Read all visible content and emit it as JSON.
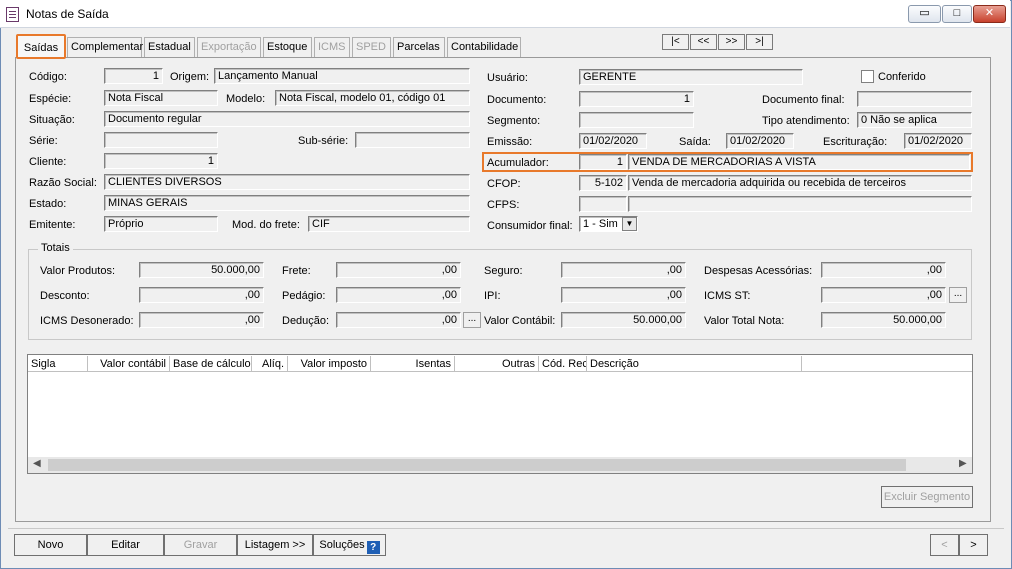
{
  "window": {
    "title": "Notas de Saída",
    "minimize": "▭",
    "maximize": "□",
    "close": "✕"
  },
  "tabs": [
    {
      "label": "Saídas",
      "active": true
    },
    {
      "label": "Complementar"
    },
    {
      "label": "Estadual"
    },
    {
      "label": "Exportação",
      "disabled": true
    },
    {
      "label": "Estoque"
    },
    {
      "label": "ICMS",
      "disabled": true
    },
    {
      "label": "SPED",
      "disabled": true
    },
    {
      "label": "Parcelas"
    },
    {
      "label": "Contabilidade"
    }
  ],
  "nav": {
    "first": "|<",
    "prev": "<<",
    "next": ">>",
    "last": ">|"
  },
  "form": {
    "codigo": {
      "label": "Código:",
      "value": "1"
    },
    "origem": {
      "label": "Origem:",
      "value": "Lançamento Manual"
    },
    "especie": {
      "label": "Espécie:",
      "value": "Nota Fiscal"
    },
    "modelo": {
      "label": "Modelo:",
      "value": "Nota Fiscal, modelo 01, código 01"
    },
    "situacao": {
      "label": "Situação:",
      "value": "Documento regular"
    },
    "serie": {
      "label": "Série:",
      "value": ""
    },
    "subserie": {
      "label": "Sub-série:",
      "value": ""
    },
    "cliente": {
      "label": "Cliente:",
      "value": "1"
    },
    "razao_social": {
      "label": "Razão Social:",
      "value": "CLIENTES DIVERSOS"
    },
    "estado": {
      "label": "Estado:",
      "value": "MINAS GERAIS"
    },
    "emitente": {
      "label": "Emitente:",
      "value": "Próprio"
    },
    "mod_frete": {
      "label": "Mod. do frete:",
      "value": "CIF"
    },
    "usuario": {
      "label": "Usuário:",
      "value": "GERENTE"
    },
    "conferido": {
      "label": "Conferido"
    },
    "documento": {
      "label": "Documento:",
      "value": "1"
    },
    "documento_final": {
      "label": "Documento final:",
      "value": ""
    },
    "segmento": {
      "label": "Segmento:",
      "value": ""
    },
    "tipo_atendimento": {
      "label": "Tipo atendimento:",
      "value": "0 Não se aplica"
    },
    "emissao": {
      "label": "Emissão:",
      "value": "01/02/2020"
    },
    "saida": {
      "label": "Saída:",
      "value": "01/02/2020"
    },
    "escrituracao": {
      "label": "Escrituração:",
      "value": "01/02/2020"
    },
    "acumulador": {
      "label": "Acumulador:",
      "code": "1",
      "desc": "VENDA DE MERCADORIAS A VISTA"
    },
    "cfop": {
      "label": "CFOP:",
      "code": "5-102",
      "desc": "Venda de mercadoria adquirida ou recebida de terceiros"
    },
    "cfps": {
      "label": "CFPS:",
      "code": "",
      "desc": ""
    },
    "consumidor_final": {
      "label": "Consumidor final:",
      "value": "1 - Sim"
    }
  },
  "totais": {
    "title": "Totais",
    "valor_produtos": {
      "label": "Valor Produtos:",
      "value": "50.000,00"
    },
    "frete": {
      "label": "Frete:",
      "value": ",00"
    },
    "seguro": {
      "label": "Seguro:",
      "value": ",00"
    },
    "despesas": {
      "label": "Despesas Acessórias:",
      "value": ",00"
    },
    "desconto": {
      "label": "Desconto:",
      "value": ",00"
    },
    "pedagio": {
      "label": "Pedágio:",
      "value": ",00"
    },
    "ipi": {
      "label": "IPI:",
      "value": ",00"
    },
    "icms_st": {
      "label": "ICMS ST:",
      "value": ",00"
    },
    "icms_desonerado": {
      "label": "ICMS Desonerado:",
      "value": ",00"
    },
    "deducao": {
      "label": "Dedução:",
      "value": ",00"
    },
    "valor_contabil": {
      "label": "Valor Contábil:",
      "value": "50.000,00"
    },
    "valor_total": {
      "label": "Valor Total Nota:",
      "value": "50.000,00"
    },
    "dots": "..."
  },
  "grid": {
    "columns": [
      "Sigla",
      "Valor contábil",
      "Base de cálculo",
      "Alíq.",
      "Valor imposto",
      "Isentas",
      "Outras",
      "Cód. Rec.",
      "Descrição"
    ]
  },
  "buttons": {
    "excluir_segmento": "Excluir Segmento",
    "novo": "Novo",
    "editar": "Editar",
    "gravar": "Gravar",
    "listagem": "Listagem >>",
    "solucoes": "Soluções",
    "help": "?",
    "prev": "<",
    "next": ">"
  }
}
